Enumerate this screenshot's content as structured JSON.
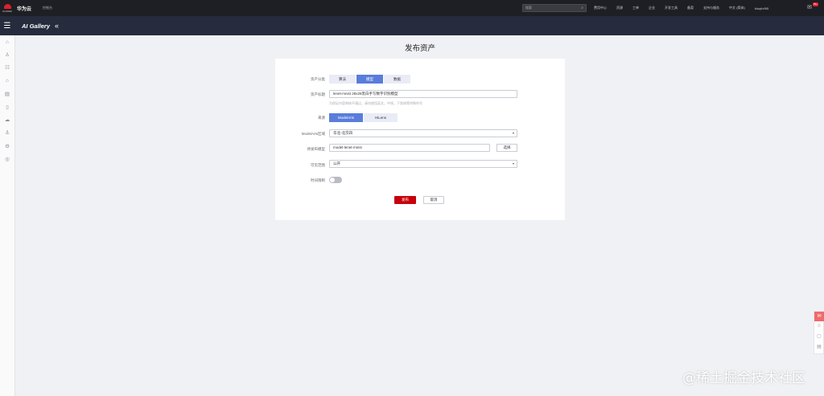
{
  "topbar": {
    "logo_text": "HUAWEI",
    "brand": "华为云",
    "console": "控制台",
    "search_placeholder": "搜索",
    "nav": [
      "费用中心",
      "资源",
      "工单",
      "企业",
      "开发工具",
      "备案",
      "支持与服务",
      "中文 (简体)",
      "kfuqfn/9l5"
    ],
    "badge": "99+"
  },
  "subbar": {
    "title": "AI Gallery"
  },
  "rail": {
    "icons": [
      "menu-icon",
      "home-icon",
      "user-icon",
      "group-icon",
      "house-icon",
      "doc-icon",
      "book-icon",
      "cloud-icon",
      "anchor-icon",
      "settings-icon",
      "help-icon"
    ]
  },
  "page": {
    "title": "发布资产"
  },
  "form": {
    "asset_type": {
      "label": "资产分类",
      "options": [
        "算法",
        "模型",
        "数据"
      ],
      "selected": "模型"
    },
    "asset_title": {
      "label": "资产标题",
      "value": "lenet-mnist 28x28黑白手写数字识别模型",
      "hint": "为保证内容审核不通过，请勿使用英文，中线，下划线等特殊符号"
    },
    "source": {
      "label": "来源",
      "options": [
        "ModelArts",
        "HiLens"
      ],
      "selected": "ModelArts"
    },
    "region": {
      "label": "ModelArts区域",
      "value": "华北-北京四"
    },
    "model_name": {
      "label": "待发布模型",
      "value": "model-lenet-mnist",
      "button": "选择"
    },
    "visibility": {
      "label": "可见范围",
      "value": "公开"
    },
    "time_limit": {
      "label": "时间限制",
      "enabled": false
    },
    "submit": "发布",
    "cancel": "取消"
  },
  "floatbar": {
    "icons": [
      "feedback-icon",
      "service-icon",
      "chat-icon",
      "note-icon"
    ]
  },
  "watermark": "@稀土掘金技术社区",
  "colors": {
    "accent": "#5a7ddb",
    "primary": "#c7000b",
    "topbar": "#1e1f24",
    "subbar": "#262b3d"
  }
}
